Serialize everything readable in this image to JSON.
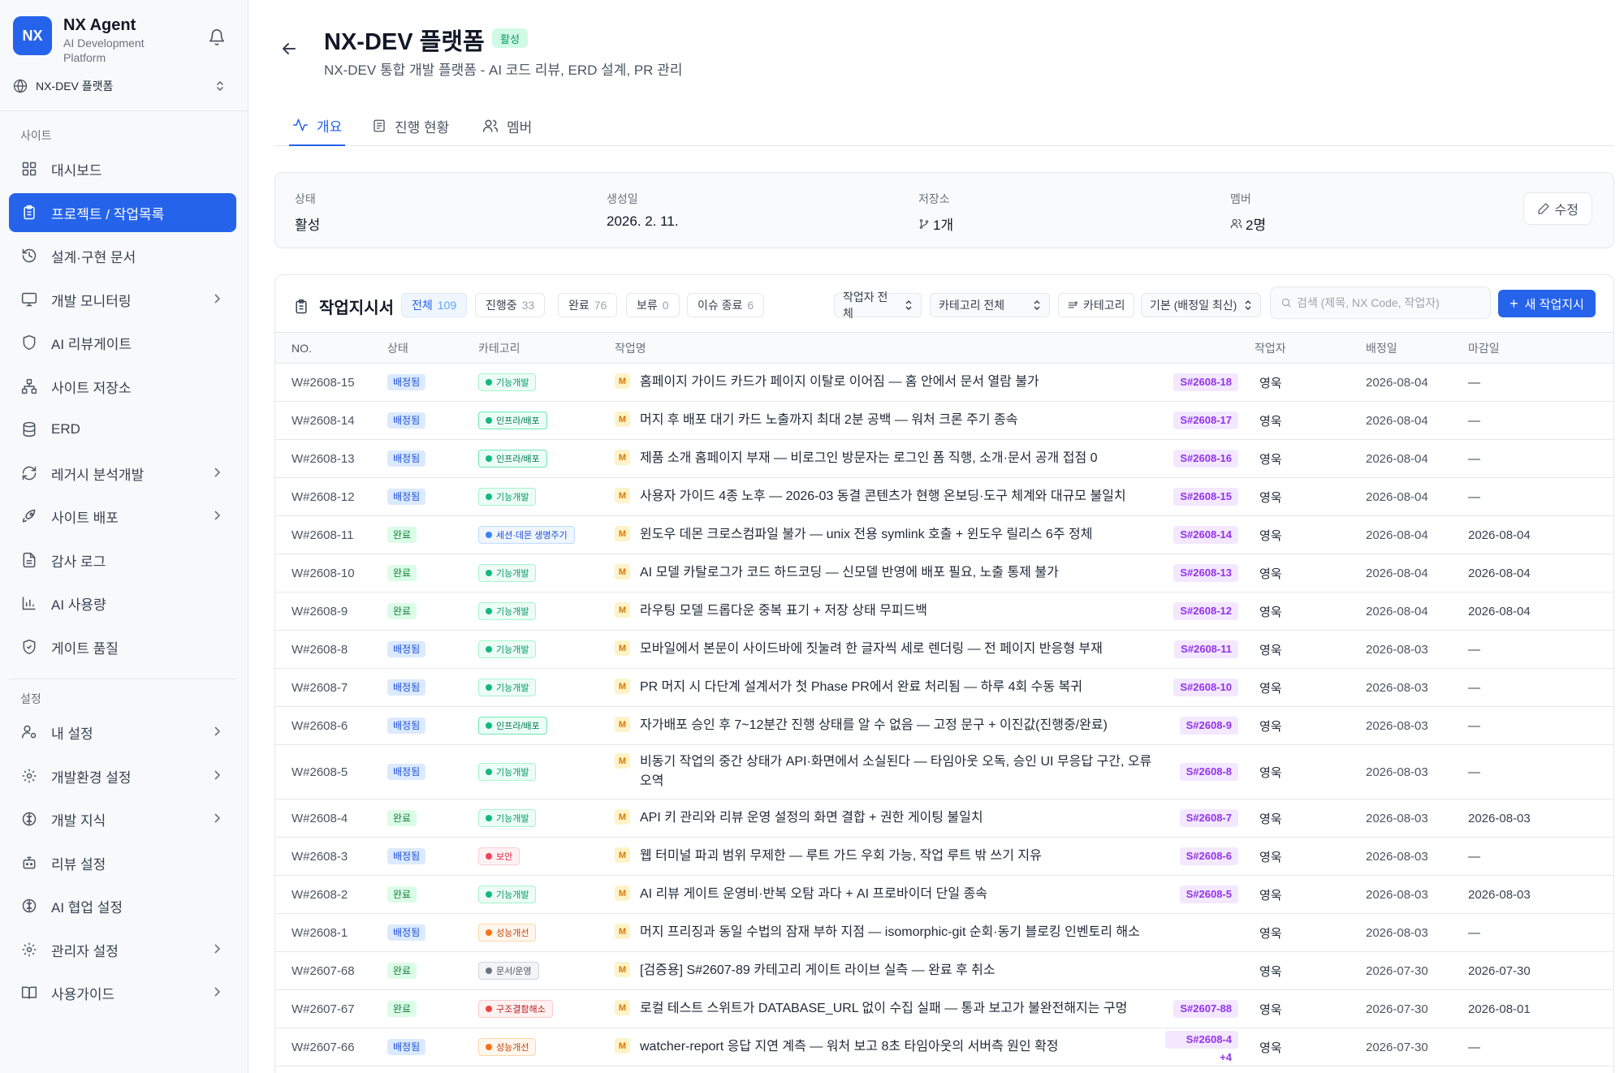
{
  "brand": {
    "logo": "NX",
    "name": "NX Agent",
    "subtitle": "AI Development Platform"
  },
  "site_selector": {
    "label": "NX-DEV 플랫폼"
  },
  "sidebar": {
    "site_section": "사이트",
    "site_items": [
      {
        "label": "대시보드",
        "icon": "dashboard-icon"
      },
      {
        "label": "프로젝트 / 작업목록",
        "icon": "clipboard-icon",
        "active": true
      },
      {
        "label": "설계·구현 문서",
        "icon": "history-icon"
      },
      {
        "label": "개발 모니터링",
        "icon": "monitor-icon",
        "expandable": true
      },
      {
        "label": "AI 리뷰게이트",
        "icon": "shield-icon"
      },
      {
        "label": "사이트 저장소",
        "icon": "sitemap-icon"
      },
      {
        "label": "ERD",
        "icon": "database-icon"
      },
      {
        "label": "레거시 분석개발",
        "icon": "refresh-icon",
        "expandable": true
      },
      {
        "label": "사이트 배포",
        "icon": "rocket-icon",
        "expandable": true
      },
      {
        "label": "감사 로그",
        "icon": "file-icon"
      },
      {
        "label": "AI 사용량",
        "icon": "bar-chart-icon"
      },
      {
        "label": "게이트 품질",
        "icon": "shield-check-icon"
      }
    ],
    "settings_section": "설정",
    "settings_items": [
      {
        "label": "내 설정",
        "icon": "user-cog-icon",
        "expandable": true
      },
      {
        "label": "개발환경 설정",
        "icon": "gear-icon",
        "expandable": true
      },
      {
        "label": "개발 지식",
        "icon": "brain-icon",
        "expandable": true
      },
      {
        "label": "리뷰 설정",
        "icon": "bot-icon"
      },
      {
        "label": "AI 협업 설정",
        "icon": "brain-icon"
      },
      {
        "label": "관리자 설정",
        "icon": "gear-icon",
        "expandable": true
      },
      {
        "label": "사용가이드",
        "icon": "book-icon",
        "expandable": true
      }
    ]
  },
  "header": {
    "title": "NX-DEV 플랫폼",
    "status": "활성",
    "description": "NX-DEV 통합 개발 플랫폼 - AI 코드 리뷰, ERD 설계, PR 관리"
  },
  "tabs": [
    {
      "label": "개요",
      "active": true
    },
    {
      "label": "진행 현황"
    },
    {
      "label": "멤버"
    }
  ],
  "summary": {
    "status_label": "상태",
    "status_value": "활성",
    "created_label": "생성일",
    "created_value": "2026. 2. 11.",
    "repo_label": "저장소",
    "repo_value": "1개",
    "member_label": "멤버",
    "member_value": "2명",
    "edit_label": "수정"
  },
  "tasks": {
    "title": "작업지시서",
    "filters": [
      {
        "label": "전체",
        "count": "109",
        "active": true
      },
      {
        "label": "진행중",
        "count": "33"
      },
      {
        "label": "완료",
        "count": "76"
      },
      {
        "label": "보류",
        "count": "0"
      },
      {
        "label": "이슈 종료",
        "count": "6"
      }
    ],
    "worker_select": "작업자 전체",
    "category_select": "카테고리 전체",
    "category_button": "카테고리",
    "sort_select": "기본 (배정일 최신)",
    "search_placeholder": "검색 (제목, NX Code, 작업자)",
    "new_button": "새 작업지시",
    "columns": [
      "NO.",
      "상태",
      "카테고리",
      "작업명",
      "작업자",
      "배정일",
      "마감일"
    ],
    "rows": [
      {
        "no": "W#2608-15",
        "status": "배정됨",
        "st": "assigned",
        "category": "기능개발",
        "cat": "feature",
        "title": "홈페이지 가이드 카드가 페이지 이탈로 이어짐 — 홈 안에서 문서 열람 불가",
        "ref": "S#2608-18",
        "worker": "영욱",
        "assigned": "2026-08-04",
        "due": "—"
      },
      {
        "no": "W#2608-14",
        "status": "배정됨",
        "st": "assigned",
        "category": "인프라/배포",
        "cat": "infra",
        "title": "머지 후 배포 대기 카드 노출까지 최대 2분 공백 — 워처 크론 주기 종속",
        "ref": "S#2608-17",
        "worker": "영욱",
        "assigned": "2026-08-04",
        "due": "—"
      },
      {
        "no": "W#2608-13",
        "status": "배정됨",
        "st": "assigned",
        "category": "인프라/배포",
        "cat": "infra",
        "title": "제품 소개 홈페이지 부재 — 비로그인 방문자는 로그인 폼 직행, 소개·문서 공개 접점 0",
        "ref": "S#2608-16",
        "worker": "영욱",
        "assigned": "2026-08-04",
        "due": "—"
      },
      {
        "no": "W#2608-12",
        "status": "배정됨",
        "st": "assigned",
        "category": "기능개발",
        "cat": "feature",
        "title": "사용자 가이드 4종 노후 — 2026-03 동결 콘텐츠가 현행 온보딩·도구 체계와 대규모 불일치",
        "ref": "S#2608-15",
        "worker": "영욱",
        "assigned": "2026-08-04",
        "due": "—"
      },
      {
        "no": "W#2608-11",
        "status": "완료",
        "st": "done",
        "category": "세션·데몬 생명주기",
        "cat": "session",
        "title": "윈도우 데몬 크로스컴파일 불가 — unix 전용 symlink 호출 + 윈도우 릴리스 6주 정체",
        "ref": "S#2608-14",
        "worker": "영욱",
        "assigned": "2026-08-04",
        "due": "2026-08-04"
      },
      {
        "no": "W#2608-10",
        "status": "완료",
        "st": "done",
        "category": "기능개발",
        "cat": "feature",
        "title": "AI 모델 카탈로그가 코드 하드코딩 — 신모델 반영에 배포 필요, 노출 통제 불가",
        "ref": "S#2608-13",
        "worker": "영욱",
        "assigned": "2026-08-04",
        "due": "2026-08-04"
      },
      {
        "no": "W#2608-9",
        "status": "완료",
        "st": "done",
        "category": "기능개발",
        "cat": "feature",
        "title": "라우팅 모델 드롭다운 중복 표기 + 저장 상태 무피드백",
        "ref": "S#2608-12",
        "worker": "영욱",
        "assigned": "2026-08-04",
        "due": "2026-08-04"
      },
      {
        "no": "W#2608-8",
        "status": "배정됨",
        "st": "assigned",
        "category": "기능개발",
        "cat": "feature",
        "title": "모바일에서 본문이 사이드바에 짓눌려 한 글자씩 세로 렌더링 — 전 페이지 반응형 부재",
        "ref": "S#2608-11",
        "worker": "영욱",
        "assigned": "2026-08-03",
        "due": "—"
      },
      {
        "no": "W#2608-7",
        "status": "배정됨",
        "st": "assigned",
        "category": "기능개발",
        "cat": "feature",
        "title": "PR 머지 시 다단계 설계서가 첫 Phase PR에서 완료 처리됨 — 하루 4회 수동 복귀",
        "ref": "S#2608-10",
        "worker": "영욱",
        "assigned": "2026-08-03",
        "due": "—"
      },
      {
        "no": "W#2608-6",
        "status": "배정됨",
        "st": "assigned",
        "category": "인프라/배포",
        "cat": "infra",
        "title": "자가배포 승인 후 7~12분간 진행 상태를 알 수 없음 — 고정 문구 + 이진값(진행중/완료)",
        "ref": "S#2608-9",
        "worker": "영욱",
        "assigned": "2026-08-03",
        "due": "—"
      },
      {
        "no": "W#2608-5",
        "status": "배정됨",
        "st": "assigned",
        "category": "기능개발",
        "cat": "feature",
        "title": "비동기 작업의 중간 상태가 API·화면에서 소실된다 — 타임아웃 오독, 승인 UI 무응답 구간, 오류 오역",
        "ref": "S#2608-8",
        "worker": "영욱",
        "assigned": "2026-08-03",
        "due": "—",
        "tall": true
      },
      {
        "no": "W#2608-4",
        "status": "완료",
        "st": "done",
        "category": "기능개발",
        "cat": "feature",
        "title": "API 키 관리와 리뷰 운영 설정의 화면 결합 + 권한 게이팅 불일치",
        "ref": "S#2608-7",
        "worker": "영욱",
        "assigned": "2026-08-03",
        "due": "2026-08-03"
      },
      {
        "no": "W#2608-3",
        "status": "배정됨",
        "st": "assigned",
        "category": "보안",
        "cat": "security",
        "title": "웹 터미널 파괴 범위 무제한 — 루트 가드 우회 가능, 작업 루트 밖 쓰기 지유",
        "ref": "S#2608-6",
        "worker": "영욱",
        "assigned": "2026-08-03",
        "due": "—"
      },
      {
        "no": "W#2608-2",
        "status": "완료",
        "st": "done",
        "category": "기능개발",
        "cat": "feature",
        "title": "AI 리뷰 게이트 운영비·반복 오탐 과다 + AI 프로바이더 단일 종속",
        "ref": "S#2608-5",
        "worker": "영욱",
        "assigned": "2026-08-03",
        "due": "2026-08-03"
      },
      {
        "no": "W#2608-1",
        "status": "배정됨",
        "st": "assigned",
        "category": "성능개선",
        "cat": "perf",
        "title": "머지 프리징과 동일 수법의 잠재 부하 지점 — isomorphic-git 순회·동기 블로킹 인벤토리 해소",
        "ref": "",
        "worker": "영욱",
        "assigned": "2026-08-03",
        "due": "—"
      },
      {
        "no": "W#2607-68",
        "status": "완료",
        "st": "done",
        "category": "문서/운영",
        "cat": "docs",
        "title": "[검증용] S#2607-89 카테고리 게이트 라이브 실측 — 완료 후 취소",
        "ref": "",
        "worker": "영욱",
        "assigned": "2026-07-30",
        "due": "2026-07-30"
      },
      {
        "no": "W#2607-67",
        "status": "완료",
        "st": "done",
        "category": "구조결함해소",
        "cat": "refactor",
        "title": "로컬 테스트 스위트가 DATABASE_URL 없이 수집 실패 — 통과 보고가 불완전해지는 구멍",
        "ref": "S#2607-88",
        "worker": "영욱",
        "assigned": "2026-07-30",
        "due": "2026-08-01"
      },
      {
        "no": "W#2607-66",
        "status": "배정됨",
        "st": "assigned",
        "category": "성능개선",
        "cat": "perf",
        "title": "watcher-report 응답 지연 계측 — 워처 보고 8초 타임아웃의 서버측 원인 확정",
        "ref": "S#2608-4 +4",
        "worker": "영욱",
        "assigned": "2026-07-30",
        "due": "—"
      }
    ]
  },
  "colors": {
    "accent": "#2563eb",
    "active_green": "#059669",
    "ref_purple": "#9333ea"
  }
}
